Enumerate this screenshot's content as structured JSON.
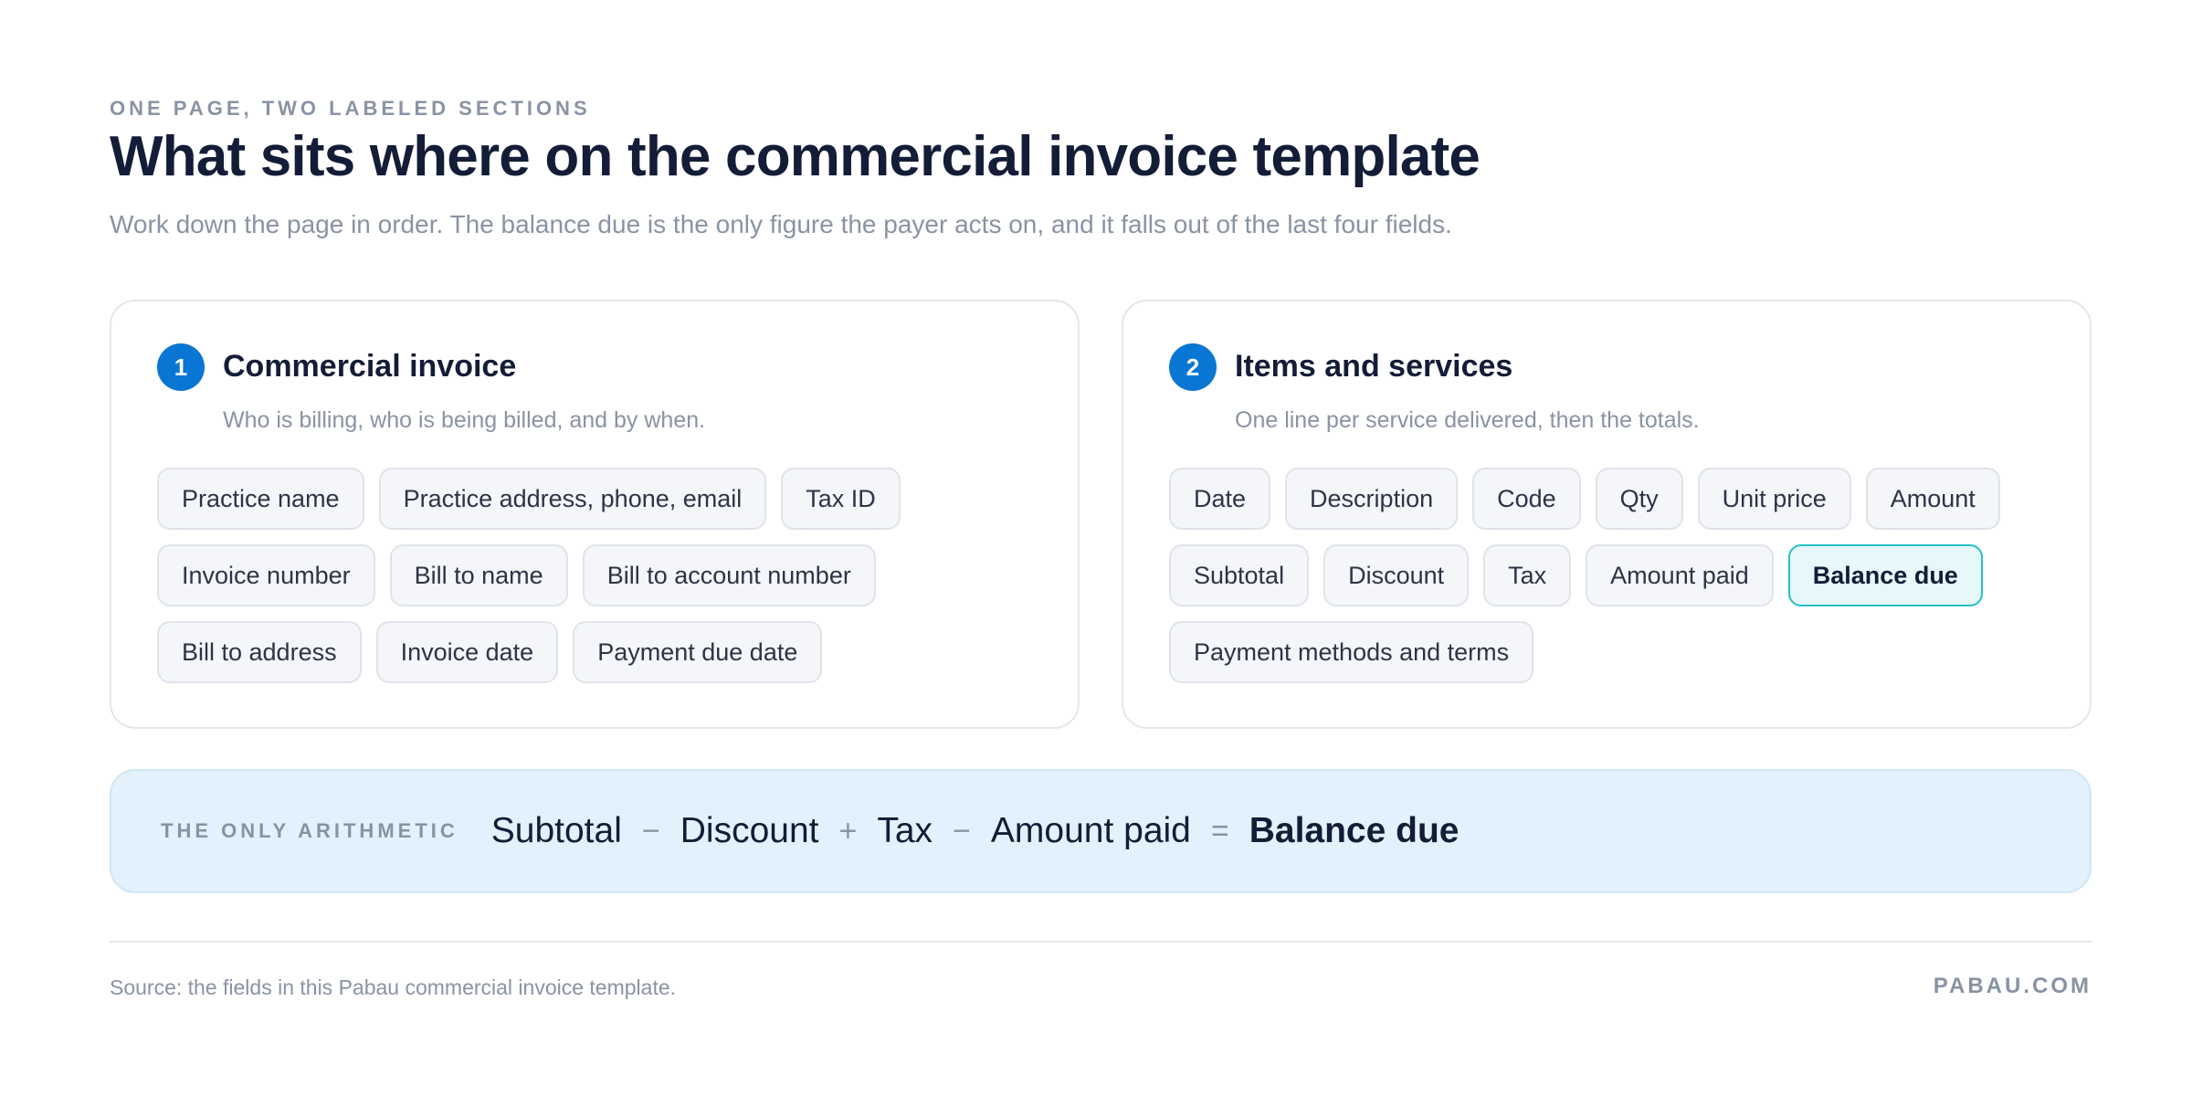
{
  "header": {
    "eyebrow": "ONE PAGE, TWO LABELED SECTIONS",
    "title": "What sits where on the commercial invoice template",
    "subtitle": "Work down the page in order. The balance due is the only figure the payer acts on, and it falls out of the last four fields."
  },
  "sections": [
    {
      "number": "1",
      "title": "Commercial invoice",
      "description": "Who is billing, who is being billed, and by when.",
      "fields": [
        "Practice name",
        "Practice address, phone, email",
        "Tax ID",
        "Invoice number",
        "Bill to name",
        "Bill to account number",
        "Bill to address",
        "Invoice date",
        "Payment due date"
      ]
    },
    {
      "number": "2",
      "title": "Items and services",
      "description": "One line per service delivered, then the totals.",
      "fields": [
        "Date",
        "Description",
        "Code",
        "Qty",
        "Unit price",
        "Amount",
        "Subtotal",
        "Discount",
        "Tax",
        "Amount paid",
        "Balance due",
        "Payment methods and terms"
      ],
      "highlighted_field": "Balance due"
    }
  ],
  "formula": {
    "label": "THE ONLY ARITHMETIC",
    "terms": [
      "Subtotal",
      "Discount",
      "Tax",
      "Amount paid",
      "Balance due"
    ],
    "operators": [
      "−",
      "+",
      "−",
      "="
    ]
  },
  "footer": {
    "source": "Source: the fields in this Pabau commercial invoice template.",
    "brand": "PABAU.COM"
  },
  "colors": {
    "accent": "#0a76d4",
    "highlight_border": "#27bfca",
    "formula_background": "#e2f1fb",
    "title": "#131d37",
    "muted": "#8a93a3"
  }
}
